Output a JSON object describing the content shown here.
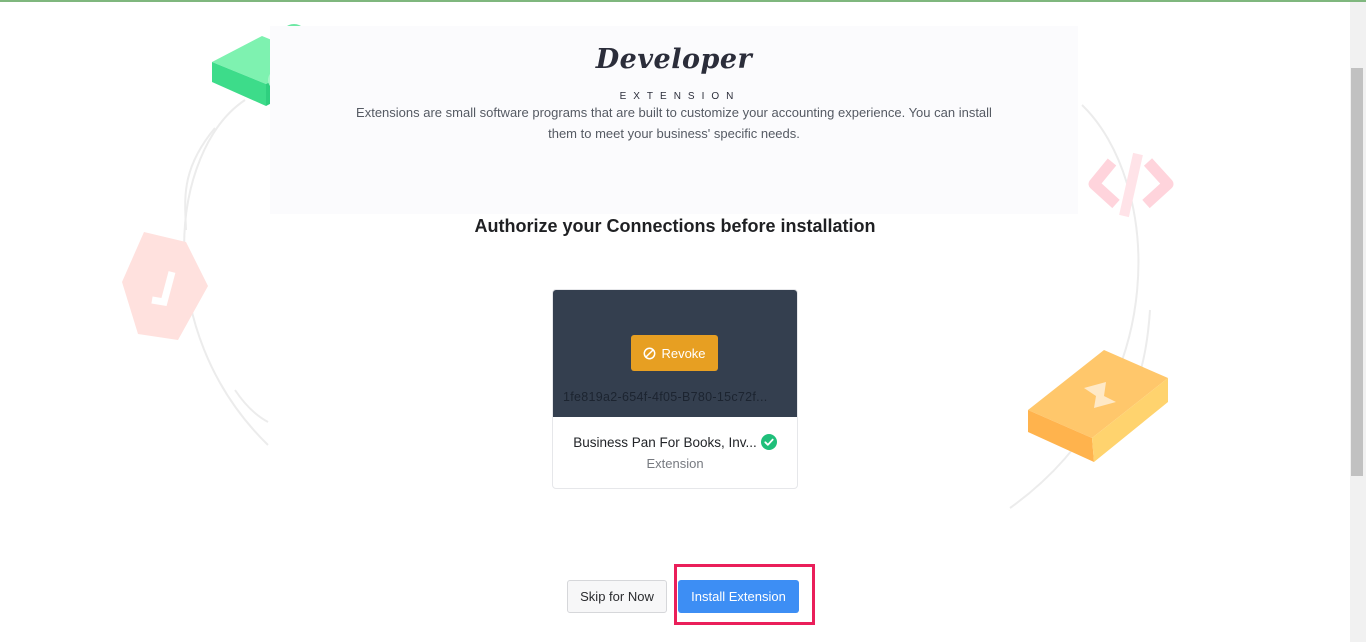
{
  "hero": {
    "title": "Developer",
    "subtitle": "EXTENSION",
    "description": "Extensions are small software programs that are built to customize your accounting experience. You can install them to meet your business' specific needs."
  },
  "heading": "Authorize your Connections before installation",
  "connection_card": {
    "revoke_label": "Revoke",
    "connection_id": "1fe819a2-654f-4f05-B780-15c72f...",
    "name": "Business Pan For Books, Inv...",
    "type": "Extension",
    "status_icon": "check-circle-icon"
  },
  "actions": {
    "skip_label": "Skip for Now",
    "install_label": "Install Extension"
  },
  "colors": {
    "card_header": "#343f4f",
    "revoke": "#e79f22",
    "install": "#3d8ef4",
    "highlight": "#ea1f5a",
    "success": "#1fbf7a"
  }
}
